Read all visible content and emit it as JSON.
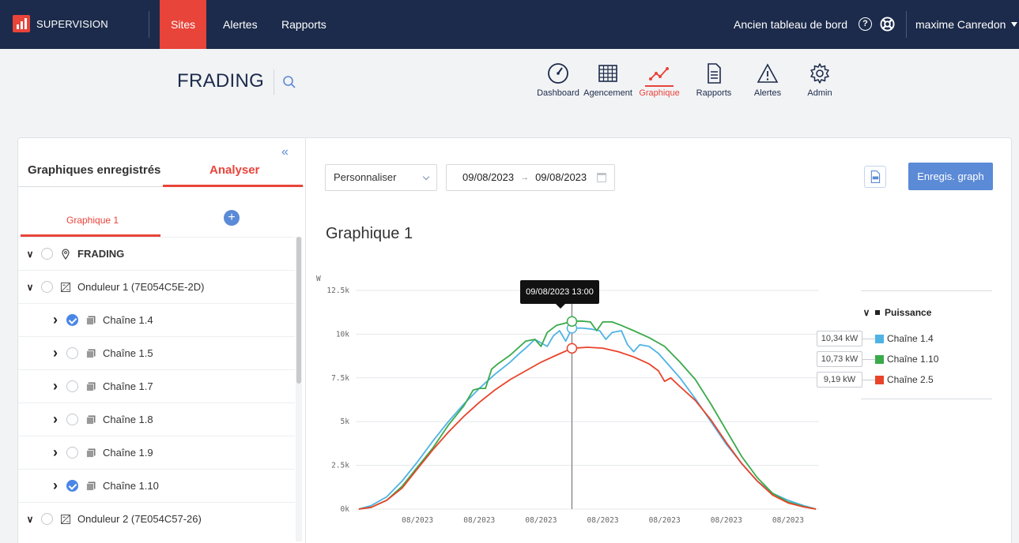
{
  "topbar": {
    "brand": "SUPERVISION",
    "nav": [
      "Sites",
      "Alertes",
      "Rapports"
    ],
    "old_dashboard": "Ancien tableau de bord",
    "help": "?",
    "user": "maxime Canredon"
  },
  "site": {
    "name": "FRADING"
  },
  "modules": [
    "Dashboard",
    "Agencement",
    "Graphique",
    "Rapports",
    "Alertes",
    "Admin"
  ],
  "sidebar": {
    "tabs": [
      "Graphiques enregistrés",
      "Analyser"
    ],
    "graph_tab": "Graphique 1",
    "add": "+",
    "collapse": "«",
    "tree": [
      {
        "label": "FRADING",
        "expanded": true,
        "checked": false,
        "icon": "pin-icon"
      },
      {
        "label": "Onduleur 1 (7E054C5E-2D)",
        "expanded": true,
        "checked": false,
        "icon": "inverter-icon"
      },
      {
        "label": "Chaîne 1.4",
        "expanded": false,
        "checked": true,
        "icon": "string-icon"
      },
      {
        "label": "Chaîne 1.5",
        "expanded": false,
        "checked": false,
        "icon": "string-icon"
      },
      {
        "label": "Chaîne 1.7",
        "expanded": false,
        "checked": false,
        "icon": "string-icon"
      },
      {
        "label": "Chaîne 1.8",
        "expanded": false,
        "checked": false,
        "icon": "string-icon"
      },
      {
        "label": "Chaîne 1.9",
        "expanded": false,
        "checked": false,
        "icon": "string-icon"
      },
      {
        "label": "Chaîne 1.10",
        "expanded": false,
        "checked": true,
        "icon": "string-icon"
      },
      {
        "label": "Onduleur 2 (7E054C57-26)",
        "expanded": true,
        "checked": false,
        "icon": "inverter-icon"
      }
    ]
  },
  "controls": {
    "period": "Personnaliser",
    "date_from": "09/08/2023",
    "arrow": "→",
    "date_to": "09/08/2023",
    "save": "Enregis. graph"
  },
  "chart_title": "Graphique 1",
  "tooltip": "09/08/2023 13:00",
  "legend": {
    "group": "Puissance",
    "items": [
      {
        "name": "Chaîne 1.4",
        "value": "10,34 kW",
        "color": "#4fb3e3"
      },
      {
        "name": "Chaîne 1.10",
        "value": "10,73 kW",
        "color": "#3aaa4a"
      },
      {
        "name": "Chaîne 2.5",
        "value": "9,19 kW",
        "color": "#e8442b"
      }
    ]
  },
  "chart_data": {
    "type": "line",
    "ylabel": "W",
    "ylim": [
      0,
      12500
    ],
    "yticks": [
      0,
      2500,
      5000,
      7500,
      10000,
      12500
    ],
    "ytick_labels": [
      "0k",
      "2.5k",
      "5k",
      "7.5k",
      "10k",
      "12.5k"
    ],
    "xlim": [
      6,
      21
    ],
    "xtick_labels": [
      "08/2023",
      "08/2023",
      "08/2023",
      "08/2023",
      "08/2023",
      "08/2023",
      "08/2023"
    ],
    "xticks": [
      8,
      10,
      12,
      14,
      16,
      18,
      20
    ],
    "cursor_x": 13,
    "series": [
      {
        "name": "Chaîne 1.4",
        "color": "#4fb3e3",
        "points": [
          [
            6.1,
            0
          ],
          [
            6.5,
            200
          ],
          [
            7,
            700
          ],
          [
            7.5,
            1600
          ],
          [
            8,
            2700
          ],
          [
            8.5,
            3900
          ],
          [
            9,
            5000
          ],
          [
            9.5,
            6000
          ],
          [
            10,
            6900
          ],
          [
            10.5,
            7700
          ],
          [
            11,
            8400
          ],
          [
            11.3,
            8900
          ],
          [
            11.5,
            9200
          ],
          [
            11.8,
            9700
          ],
          [
            12,
            9500
          ],
          [
            12.2,
            9300
          ],
          [
            12.4,
            9900
          ],
          [
            12.6,
            10200
          ],
          [
            12.8,
            9600
          ],
          [
            13,
            10340
          ],
          [
            13.3,
            10350
          ],
          [
            13.6,
            10300
          ],
          [
            13.9,
            10200
          ],
          [
            14.1,
            9700
          ],
          [
            14.3,
            10100
          ],
          [
            14.6,
            10200
          ],
          [
            14.8,
            9400
          ],
          [
            15,
            9000
          ],
          [
            15.2,
            9400
          ],
          [
            15.5,
            9300
          ],
          [
            15.8,
            8900
          ],
          [
            16,
            8500
          ],
          [
            16.5,
            7500
          ],
          [
            17,
            6300
          ],
          [
            17.5,
            5000
          ],
          [
            18,
            3700
          ],
          [
            18.5,
            2600
          ],
          [
            19,
            1600
          ],
          [
            19.5,
            900
          ],
          [
            20,
            500
          ],
          [
            20.5,
            200
          ],
          [
            20.9,
            0
          ]
        ]
      },
      {
        "name": "Chaîne 1.10",
        "color": "#3aaa4a",
        "points": [
          [
            6.1,
            0
          ],
          [
            6.5,
            100
          ],
          [
            7,
            500
          ],
          [
            7.5,
            1300
          ],
          [
            8,
            2400
          ],
          [
            8.5,
            3500
          ],
          [
            9,
            4800
          ],
          [
            9.5,
            5900
          ],
          [
            9.8,
            6800
          ],
          [
            10,
            6900
          ],
          [
            10.2,
            6900
          ],
          [
            10.4,
            8000
          ],
          [
            10.6,
            8300
          ],
          [
            11,
            8800
          ],
          [
            11.5,
            9600
          ],
          [
            11.8,
            9700
          ],
          [
            12,
            9300
          ],
          [
            12.2,
            10100
          ],
          [
            12.5,
            10500
          ],
          [
            13,
            10730
          ],
          [
            13.3,
            10750
          ],
          [
            13.6,
            10700
          ],
          [
            13.8,
            10200
          ],
          [
            14,
            10700
          ],
          [
            14.3,
            10700
          ],
          [
            14.6,
            10500
          ],
          [
            15,
            10200
          ],
          [
            15.5,
            9800
          ],
          [
            16,
            9300
          ],
          [
            16.5,
            8400
          ],
          [
            17,
            7400
          ],
          [
            17.5,
            6000
          ],
          [
            18,
            4500
          ],
          [
            18.5,
            3000
          ],
          [
            19,
            1800
          ],
          [
            19.5,
            900
          ],
          [
            20,
            400
          ],
          [
            20.5,
            150
          ],
          [
            20.9,
            0
          ]
        ]
      },
      {
        "name": "Chaîne 2.5",
        "color": "#e8442b",
        "points": [
          [
            6.1,
            0
          ],
          [
            6.5,
            100
          ],
          [
            7,
            500
          ],
          [
            7.5,
            1200
          ],
          [
            8,
            2300
          ],
          [
            8.5,
            3400
          ],
          [
            9,
            4400
          ],
          [
            9.5,
            5300
          ],
          [
            10,
            6100
          ],
          [
            10.5,
            6800
          ],
          [
            11,
            7400
          ],
          [
            11.5,
            7900
          ],
          [
            12,
            8400
          ],
          [
            12.5,
            8800
          ],
          [
            13,
            9190
          ],
          [
            13.5,
            9250
          ],
          [
            14,
            9200
          ],
          [
            14.5,
            9000
          ],
          [
            15,
            8700
          ],
          [
            15.5,
            8300
          ],
          [
            15.8,
            7900
          ],
          [
            16,
            7300
          ],
          [
            16.2,
            7500
          ],
          [
            16.5,
            7000
          ],
          [
            17,
            6200
          ],
          [
            17.5,
            5100
          ],
          [
            18,
            3800
          ],
          [
            18.5,
            2600
          ],
          [
            19,
            1600
          ],
          [
            19.5,
            800
          ],
          [
            20,
            350
          ],
          [
            20.5,
            120
          ],
          [
            20.9,
            0
          ]
        ]
      }
    ]
  }
}
